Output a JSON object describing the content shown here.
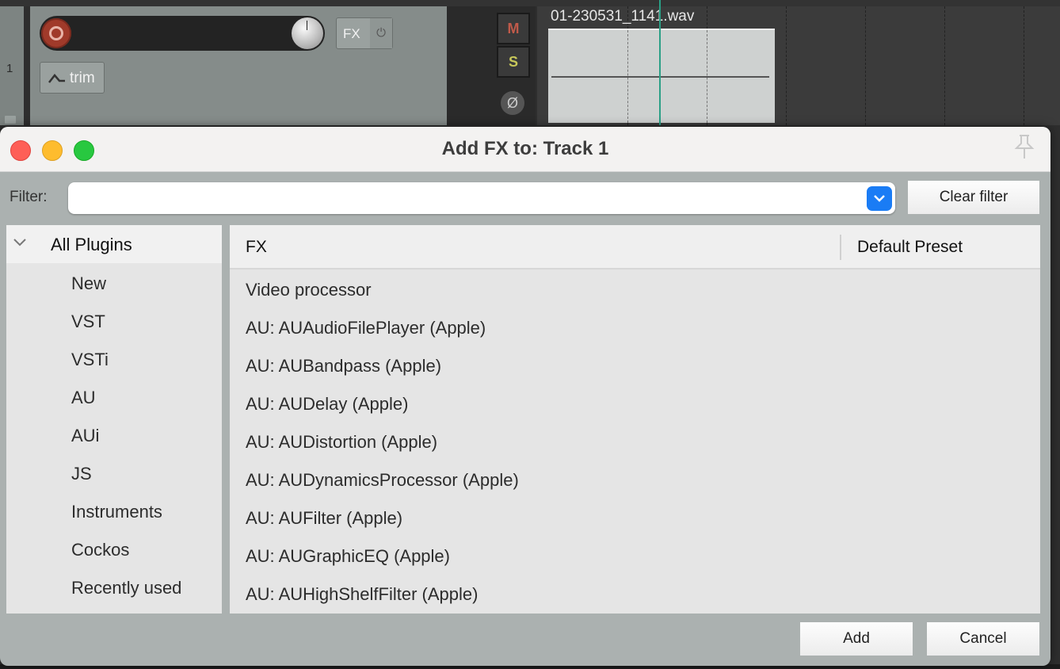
{
  "daw": {
    "track_number": "1",
    "fx_button_label": "FX",
    "power_icon": "⏻",
    "trim_label": "trim",
    "mute_label": "M",
    "solo_label": "S",
    "phase_label": "Ø",
    "media_item_name": "01-230531_1141.wav"
  },
  "dialog": {
    "title": "Add FX to: Track 1",
    "filter": {
      "label": "Filter:",
      "value": "",
      "placeholder": ""
    },
    "clear_filter_label": "Clear filter",
    "tree": {
      "root_label": "All Plugins",
      "items": [
        {
          "label": "New"
        },
        {
          "label": "VST"
        },
        {
          "label": "VSTi"
        },
        {
          "label": "AU"
        },
        {
          "label": "AUi"
        },
        {
          "label": "JS"
        },
        {
          "label": "Instruments"
        },
        {
          "label": "Cockos"
        },
        {
          "label": "Recently used"
        }
      ]
    },
    "list": {
      "columns": [
        "FX",
        "Default Preset"
      ],
      "rows": [
        {
          "fx": "Video processor",
          "preset": ""
        },
        {
          "fx": "AU: AUAudioFilePlayer (Apple)",
          "preset": ""
        },
        {
          "fx": "AU: AUBandpass (Apple)",
          "preset": ""
        },
        {
          "fx": "AU: AUDelay (Apple)",
          "preset": ""
        },
        {
          "fx": "AU: AUDistortion (Apple)",
          "preset": ""
        },
        {
          "fx": "AU: AUDynamicsProcessor (Apple)",
          "preset": ""
        },
        {
          "fx": "AU: AUFilter (Apple)",
          "preset": ""
        },
        {
          "fx": "AU: AUGraphicEQ (Apple)",
          "preset": ""
        },
        {
          "fx": "AU: AUHighShelfFilter (Apple)",
          "preset": ""
        }
      ]
    },
    "add_label": "Add",
    "cancel_label": "Cancel"
  },
  "colors": {
    "accent_blue": "#1a7cf5",
    "close": "#fe5f57",
    "minimize": "#febc2e",
    "zoom": "#28c840",
    "playhead": "#2aa086"
  }
}
